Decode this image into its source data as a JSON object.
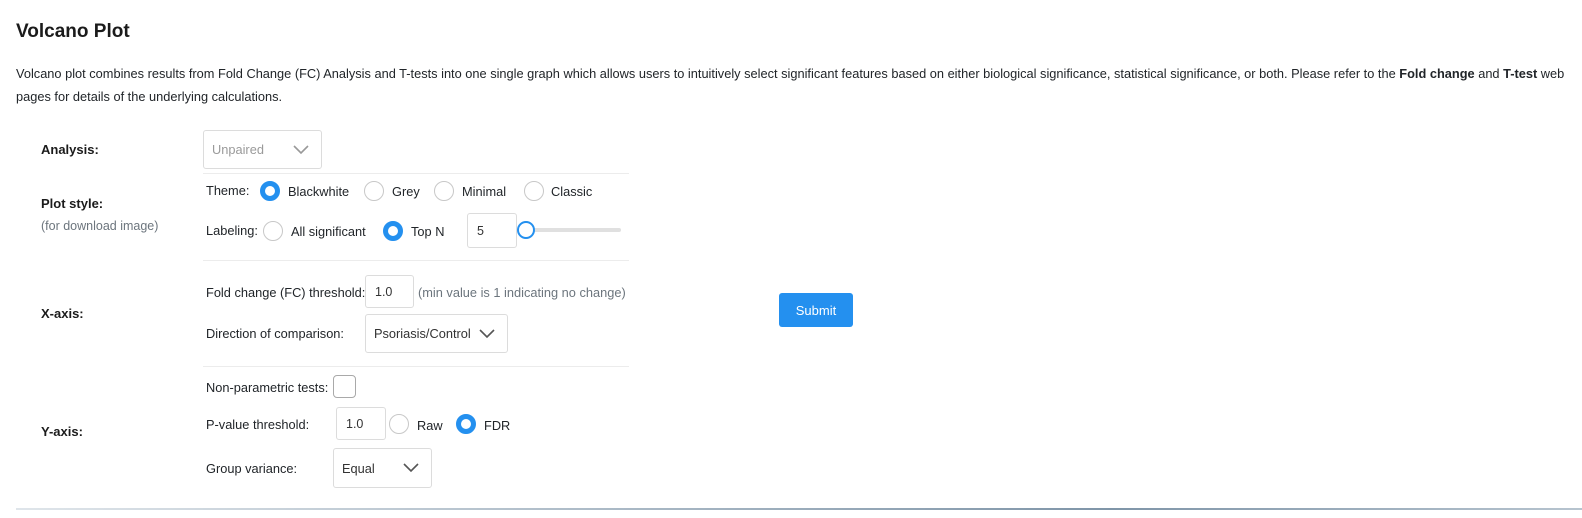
{
  "page": {
    "title": "Volcano Plot",
    "description_before": "Volcano plot combines results from Fold Change (FC) Analysis and T-tests into one single graph which allows users to intuitively select significant features based on either biological significance, statistical significance, or both. Please refer to the ",
    "link_fold_change": "Fold change",
    "description_and": " and ",
    "link_ttest": "T-test",
    "description_after": " web pages for details of the underlying calculations."
  },
  "analysis": {
    "label": "Analysis:",
    "value": "Unpaired"
  },
  "plot_style": {
    "label": "Plot style:",
    "sublabel": "(for download image)",
    "theme_label": "Theme:",
    "themes": [
      "Blackwhite",
      "Grey",
      "Minimal",
      "Classic"
    ],
    "selected_theme": "Blackwhite",
    "labeling_label": "Labeling:",
    "labeling_options": [
      "All significant",
      "Top N"
    ],
    "selected_labeling": "Top N",
    "top_n_value": "5"
  },
  "x_axis": {
    "label": "X-axis:",
    "fc_label": "Fold change (FC) threshold:",
    "fc_value": "1.0",
    "fc_hint": "(min value is 1 indicating no change)",
    "direction_label": "Direction of comparison:",
    "direction_value": "Psoriasis/Control"
  },
  "y_axis": {
    "label": "Y-axis:",
    "nonparam_label": "Non-parametric tests:",
    "nonparam_checked": false,
    "pvalue_label": "P-value threshold:",
    "pvalue_value": "1.0",
    "pvalue_options": [
      "Raw",
      "FDR"
    ],
    "selected_pvalue": "FDR",
    "variance_label": "Group variance:",
    "variance_value": "Equal"
  },
  "submit_label": "Submit",
  "colors": {
    "accent": "#2490ef"
  },
  "icons": {
    "dropdown": "chevron-down-icon"
  }
}
